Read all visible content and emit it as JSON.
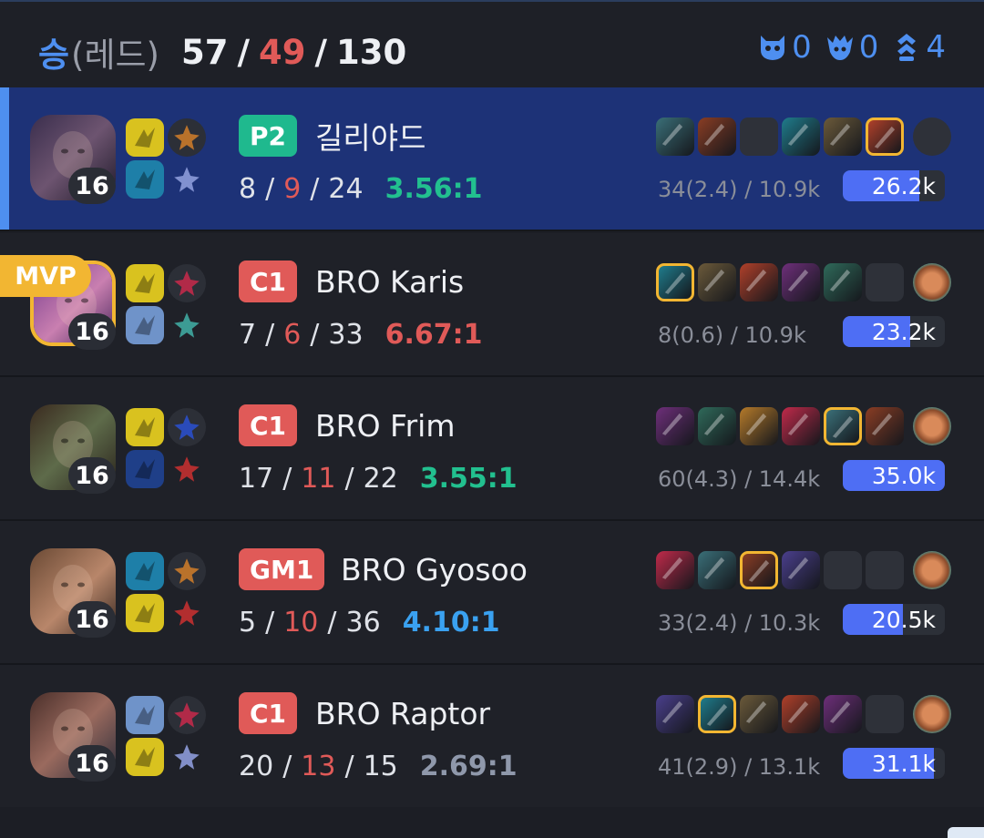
{
  "header": {
    "result": "승",
    "team": "(레드)",
    "kills": "57",
    "deaths": "49",
    "assists": "130",
    "objectives": [
      {
        "icon": "baron-icon",
        "count": "0"
      },
      {
        "icon": "dragon-icon",
        "count": "0"
      },
      {
        "icon": "tower-icon",
        "count": "4"
      }
    ]
  },
  "colors": {
    "accent": "#4e8ff0",
    "deaths": "#e05a58",
    "mvp": "#f2b632",
    "highlight_row": "#1d3277"
  },
  "players": [
    {
      "tier": "P2",
      "tier_color": "#1fb98e",
      "name": "길리야드",
      "level": "16",
      "kills": "8",
      "deaths": "9",
      "assists": "24",
      "ratio": "3.56:1",
      "ratio_color": "#22c08f",
      "cs": "34(2.4) / 10.9k",
      "damage": "26.2k",
      "damage_fraction": 0.75,
      "mvp": false,
      "highlight": true,
      "portrait": "kaisa-portrait",
      "spells": [
        "flash-spell-icon",
        "ghost-spell-icon"
      ],
      "runes": [
        "conqueror-rune-icon",
        "sorcery-rune-icon"
      ],
      "items": [
        "item-1",
        "item-2",
        "empty",
        "item-3",
        "item-4",
        "item-5-gold"
      ],
      "ward": "empty"
    },
    {
      "tier": "C1",
      "tier_color": "#e05a58",
      "name": "BRO Karis",
      "level": "16",
      "kills": "7",
      "deaths": "6",
      "assists": "33",
      "ratio": "6.67:1",
      "ratio_color": "#e05a58",
      "cs": "8(0.6) / 10.9k",
      "damage": "23.2k",
      "damage_fraction": 0.66,
      "mvp": true,
      "mvp_label": "MVP",
      "highlight": false,
      "portrait": "support-portrait",
      "spells": [
        "flash-spell-icon",
        "exhaust-spell-icon"
      ],
      "runes": [
        "electrocute-rune-icon",
        "resolve-rune-icon"
      ],
      "items": [
        "item-gold",
        "item-2",
        "item-3",
        "item-4",
        "item-5",
        "empty"
      ],
      "ward": "oracle-lens-icon"
    },
    {
      "tier": "C1",
      "tier_color": "#e05a58",
      "name": "BRO Frim",
      "level": "16",
      "kills": "17",
      "deaths": "11",
      "assists": "22",
      "ratio": "3.55:1",
      "ratio_color": "#22c08f",
      "cs": "60(4.3) / 14.4k",
      "damage": "35.0k",
      "damage_fraction": 1.0,
      "mvp": false,
      "highlight": false,
      "portrait": "jungle-portrait",
      "spells": [
        "flash-spell-icon",
        "smite-spell-icon"
      ],
      "runes": [
        "comet-rune-icon",
        "domination-rune-icon"
      ],
      "items": [
        "item-1",
        "item-2",
        "item-3",
        "item-4",
        "item-5-gold",
        "item-6"
      ],
      "ward": "oracle-lens-icon"
    },
    {
      "tier": "GM1",
      "tier_color": "#e05a58",
      "name": "BRO Gyosoo",
      "level": "16",
      "kills": "5",
      "deaths": "10",
      "assists": "36",
      "ratio": "4.10:1",
      "ratio_color": "#3aa1f0",
      "cs": "33(2.4) / 10.3k",
      "damage": "20.5k",
      "damage_fraction": 0.59,
      "mvp": false,
      "highlight": false,
      "portrait": "graves-portrait",
      "spells": [
        "ghost-spell-icon",
        "flash-spell-icon"
      ],
      "runes": [
        "conqueror-rune-icon",
        "domination-rune-icon"
      ],
      "items": [
        "item-1",
        "item-2",
        "item-3-gold",
        "item-4",
        "empty",
        "empty"
      ],
      "ward": "oracle-lens-icon"
    },
    {
      "tier": "C1",
      "tier_color": "#e05a58",
      "name": "BRO Raptor",
      "level": "16",
      "kills": "20",
      "deaths": "13",
      "assists": "15",
      "ratio": "2.69:1",
      "ratio_color": "#8f98ab",
      "cs": "41(2.9) / 13.1k",
      "damage": "31.1k",
      "damage_fraction": 0.89,
      "mvp": false,
      "highlight": false,
      "portrait": "ekko-portrait",
      "spells": [
        "exhaust-spell-icon",
        "flash-spell-icon"
      ],
      "runes": [
        "electrocute-rune-icon",
        "sorcery-rune-icon"
      ],
      "items": [
        "item-1",
        "item-2-gold",
        "item-3",
        "item-4",
        "item-5",
        "empty"
      ],
      "ward": "oracle-lens-icon"
    }
  ]
}
